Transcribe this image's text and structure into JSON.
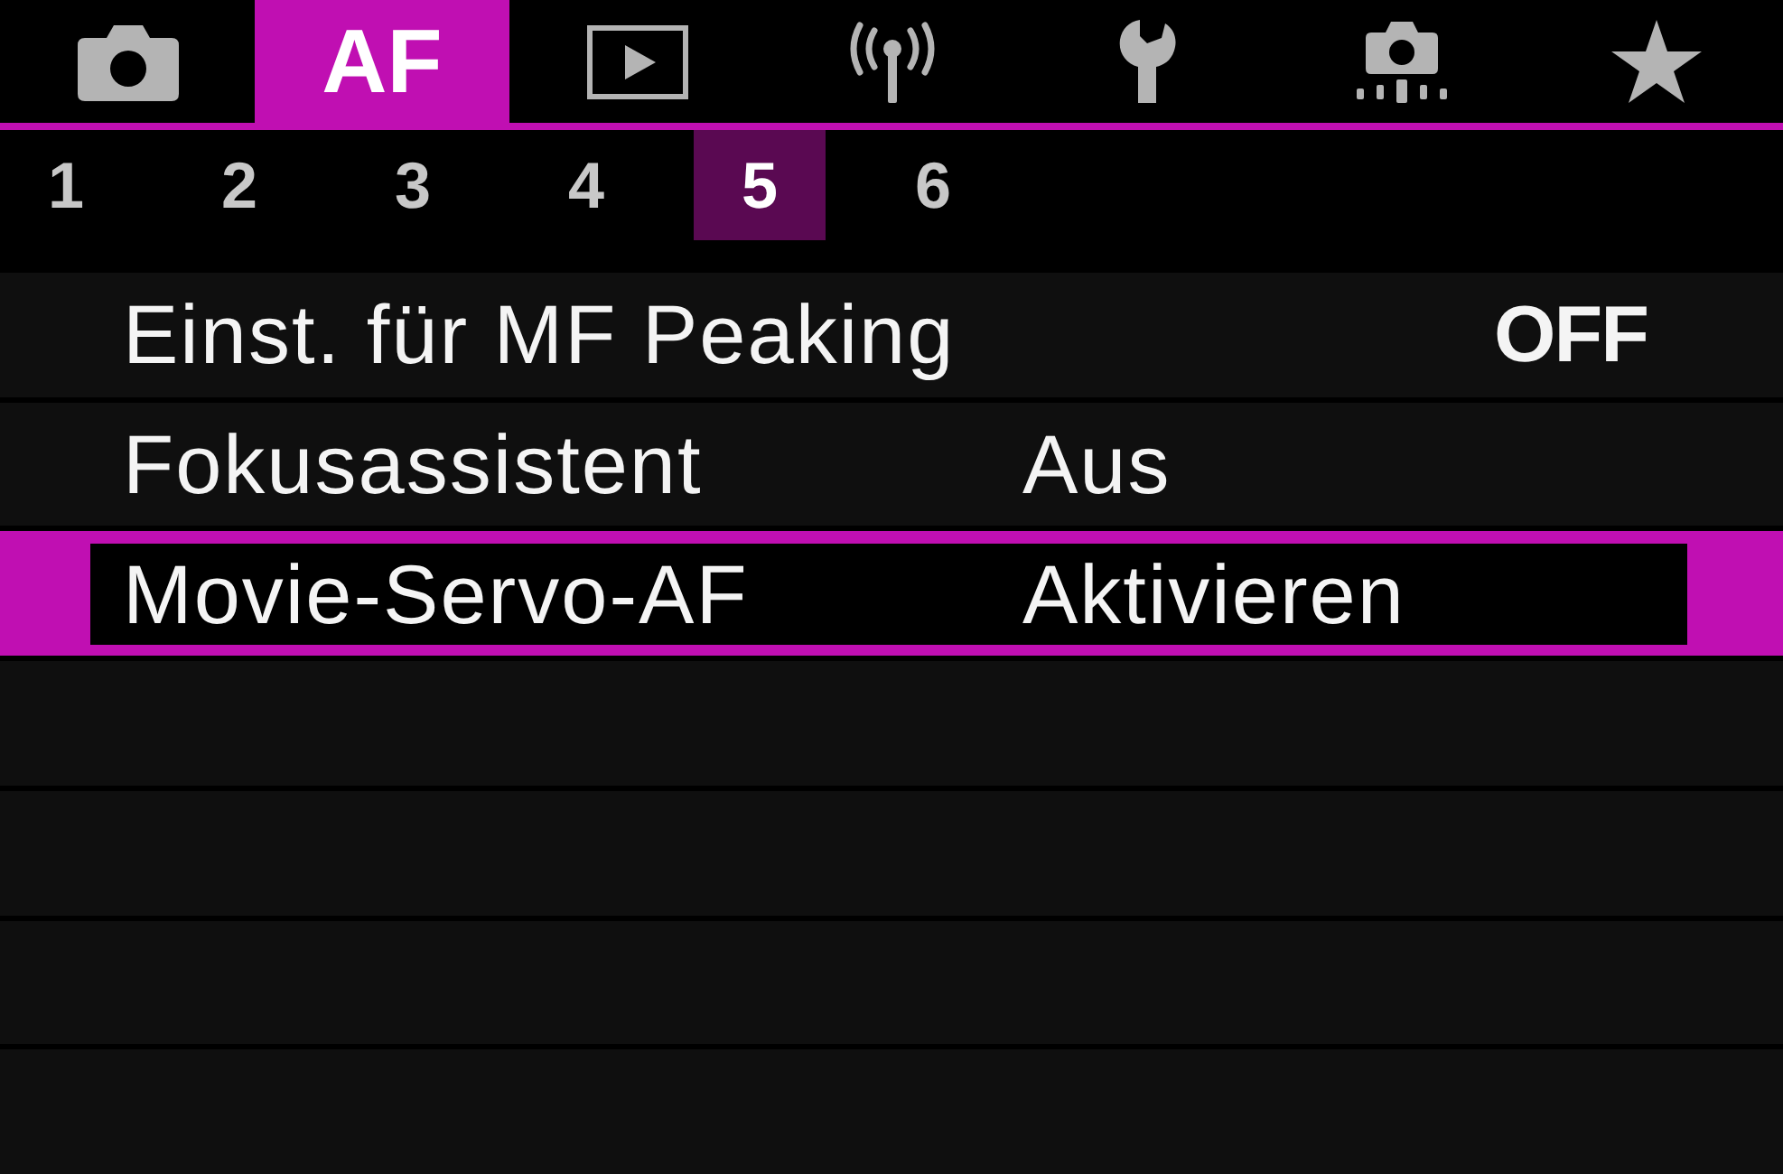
{
  "tabs": [
    {
      "kind": "camera",
      "selected": false
    },
    {
      "kind": "text",
      "label": "AF",
      "selected": true
    },
    {
      "kind": "playback",
      "selected": false
    },
    {
      "kind": "wireless",
      "selected": false
    },
    {
      "kind": "wrench",
      "selected": false
    },
    {
      "kind": "custom",
      "selected": false
    },
    {
      "kind": "star",
      "selected": false
    }
  ],
  "pages": [
    {
      "label": "1",
      "selected": false
    },
    {
      "label": "2",
      "selected": false
    },
    {
      "label": "3",
      "selected": false
    },
    {
      "label": "4",
      "selected": false
    },
    {
      "label": "5",
      "selected": true
    },
    {
      "label": "6",
      "selected": false
    }
  ],
  "menu": {
    "items": [
      {
        "label": "Einst. für MF Peaking",
        "value": "OFF",
        "kind": "switch",
        "selected": false
      },
      {
        "label": "Fokusassistent",
        "value": "Aus",
        "kind": "option",
        "selected": false
      },
      {
        "label": "Movie-Servo-AF",
        "value": "Aktivieren",
        "kind": "option",
        "selected": true
      }
    ]
  }
}
